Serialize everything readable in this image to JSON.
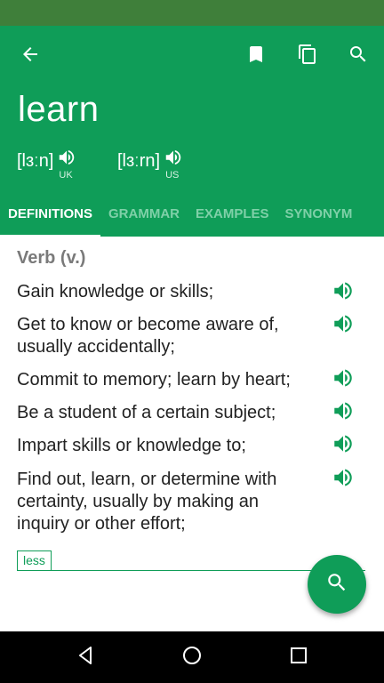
{
  "header": {
    "word": "learn",
    "pronunciations": [
      {
        "ipa": "[lɜːn]",
        "region": "UK"
      },
      {
        "ipa": "[lɜːrn]",
        "region": "US"
      }
    ]
  },
  "icons": {
    "back": "arrow-back-icon",
    "bookmark": "bookmark-icon",
    "copy": "copy-icon",
    "search": "search-icon",
    "speaker": "volume-icon"
  },
  "tabs": [
    "DEFINITIONS",
    "GRAMMAR",
    "EXAMPLES",
    "SYNONYM"
  ],
  "active_tab": "DEFINITIONS",
  "content": {
    "part_of_speech": "Verb (v.)",
    "definitions": [
      "Gain knowledge or skills;",
      "Get to know or become aware of, usually accidentally;",
      "Commit to memory; learn by heart;",
      "Be a student of a certain subject;",
      "Impart skills or knowledge to;",
      "Find out, learn, or determine with certainty, usually by making an inquiry or other effort;"
    ],
    "less_label": "less"
  },
  "colors": {
    "primary": "#0f9d58",
    "status_bar": "#3f7f3a",
    "inactive_tab": "#7fd0a8"
  }
}
